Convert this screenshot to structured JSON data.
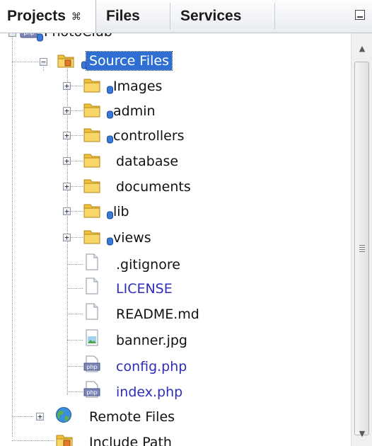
{
  "tabs": [
    {
      "label": "Projects",
      "close_icon": "close-icon",
      "active": true
    },
    {
      "label": "Files",
      "active": false
    },
    {
      "label": "Services",
      "active": false
    }
  ],
  "panel_minimize_icon": "minimize-icon",
  "tree": {
    "project": {
      "label": "PhotoClub",
      "icon": "php-project-icon"
    },
    "source_files": {
      "label": "Source Files",
      "icon": "source-folder-icon"
    },
    "children": [
      {
        "label": "Images",
        "icon": "folder-icon",
        "badge": "db-badge-icon"
      },
      {
        "label": "admin",
        "icon": "folder-icon",
        "badge": "db-badge-icon"
      },
      {
        "label": "controllers",
        "icon": "folder-icon",
        "badge": "db-badge-icon"
      },
      {
        "label": "database",
        "icon": "folder-icon"
      },
      {
        "label": "documents",
        "icon": "folder-icon"
      },
      {
        "label": "lib",
        "icon": "folder-icon",
        "badge": "db-badge-icon"
      },
      {
        "label": "views",
        "icon": "folder-icon",
        "badge": "db-badge-icon"
      },
      {
        "label": ".gitignore",
        "icon": "file-icon"
      },
      {
        "label": "LICENSE",
        "icon": "file-icon"
      },
      {
        "label": "README.md",
        "icon": "file-icon"
      },
      {
        "label": "banner.jpg",
        "icon": "image-file-icon"
      },
      {
        "label": "config.php",
        "icon": "php-file-icon"
      },
      {
        "label": "index.php",
        "icon": "php-file-icon"
      }
    ],
    "remote_files": {
      "label": "Remote Files",
      "icon": "globe-icon"
    },
    "include_path": {
      "label": "Include Path",
      "icon": "library-folder-icon"
    }
  },
  "colors": {
    "selection": "#2f6fd3",
    "modified_text": "#2e2eb8",
    "folder": "#f3c23c"
  }
}
